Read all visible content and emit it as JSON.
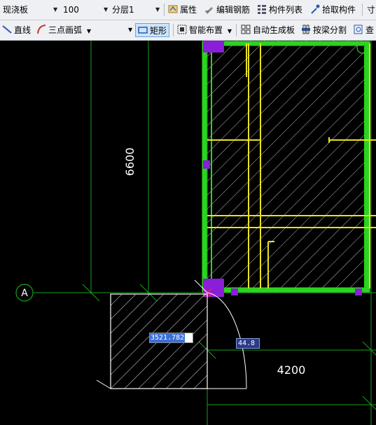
{
  "toolbar1": {
    "component_type": "现浇板",
    "thickness": "100",
    "layer": "分层1",
    "props_label": "属性",
    "edit_rebar_label": "编辑钢筋",
    "component_list_label": "构件列表",
    "pick_component_label": "拾取构件",
    "overflow_label": "寸"
  },
  "toolbar2": {
    "line_label": "直线",
    "arc_label": "三点画弧",
    "rect_label": "矩形",
    "smart_layout_label": "智能布置",
    "auto_gen_label": "自动生成板",
    "split_label": "按梁分割",
    "query_label": "查"
  },
  "canvas": {
    "dim_vertical": "6600",
    "dim_horizontal": "4200",
    "axis_label": "A",
    "length_input": "3521.782",
    "angle_input": "44.8"
  },
  "colors": {
    "beam_green": "#2bd41f",
    "rebar_yellow": "#e8e31e",
    "column_purple": "#8a1ed9",
    "axis_green": "#1aa01a",
    "preview_white": "#ffffff"
  }
}
